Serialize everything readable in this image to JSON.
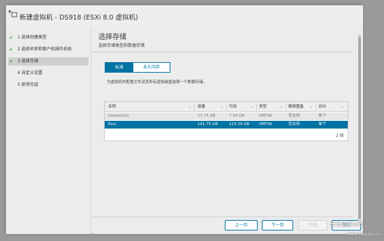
{
  "dialog": {
    "title": "新建虚拟机 - DS918 (ESXi 8.0 虚拟机)",
    "title_icon": "add-vm-icon"
  },
  "sidebar": {
    "steps": [
      {
        "label": "1 选择创建类型",
        "completed": true,
        "active": false
      },
      {
        "label": "2 选择名称和客户机操作系统",
        "completed": true,
        "active": false
      },
      {
        "label": "3 选择存储",
        "completed": true,
        "active": true
      },
      {
        "label": "4 自定义设置",
        "completed": false,
        "active": false
      },
      {
        "label": "5 即将完成",
        "completed": false,
        "active": false
      }
    ],
    "check_glyph": "✔"
  },
  "main": {
    "title": "选择存储",
    "subtitle": "选择存储类型和数据存储",
    "storage_type": {
      "options": [
        "标准",
        "永久内存"
      ],
      "selected": "标准"
    },
    "description": "为虚拟机的配置文件及其所有虚拟磁盘选择一个数据存储。",
    "table": {
      "columns": [
        "名称",
        "容量",
        "可用",
        "类型",
        "精简置备",
        "访问"
      ],
      "sort_glyph": "⌄",
      "rows": [
        [
          "datastore1",
          "13.75 GB",
          "7.34 GB",
          "VMFS6",
          "受支持",
          "单个"
        ],
        [
          "Esxi",
          "141.75 GB",
          "123.34 GB",
          "VMFS6",
          "受支持",
          "单个"
        ]
      ],
      "selected_row": 1,
      "item_count": "2 项"
    }
  },
  "footer": {
    "back": "上一页",
    "next": "下一页",
    "finish": "完成",
    "cancel": "取消",
    "finish_enabled": false
  },
  "watermark": {
    "text": "吾爱破解论坛",
    "url": "www.52pojie.cn"
  },
  "colors": {
    "accent": "#0072a3",
    "check": "#2e9e3a",
    "selected_row": "#0072a3"
  }
}
